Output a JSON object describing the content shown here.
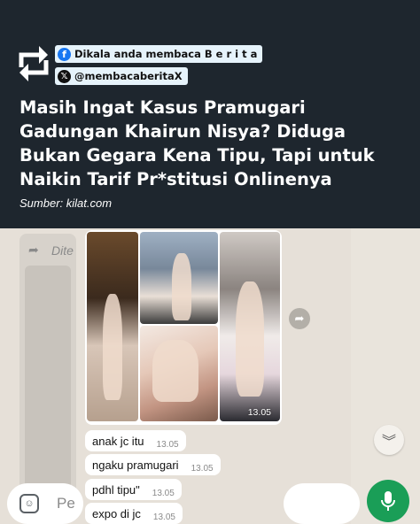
{
  "header": {
    "fb_tag": "Dikala anda membaca B e r i t a",
    "x_tag": "@membacaberitaX",
    "headline": "Masih Ingat Kasus Pramugari Gadungan Khairun Nisya? Diduga Bukan Gegara Kena Tipu, Tapi untuk Naikin Tarif Pr*stitusi Onlinenya",
    "source": "Sumber: kilat.com"
  },
  "chat": {
    "bg_bubble_text": "Dite",
    "photo_time": "13.05",
    "messages": [
      {
        "text": "anak jc itu",
        "time": "13.05"
      },
      {
        "text": "ngaku pramugari",
        "time": "13.05"
      },
      {
        "text": "pdhl tipu\"",
        "time": "13.05"
      },
      {
        "text": "expo di jc",
        "time": "13.05"
      }
    ],
    "composer_placeholder": "Pe"
  },
  "colors": {
    "header_bg": "#1e262e",
    "tag_bg": "#e6f3fb",
    "chat_bg": "#e6e0d8",
    "mic_green": "#1a9e57"
  },
  "icons": [
    "repost-logo-icon",
    "facebook-icon",
    "x-icon",
    "forward-icon",
    "share-icon",
    "chevron-double-down-icon",
    "sticker-icon",
    "mic-icon"
  ]
}
